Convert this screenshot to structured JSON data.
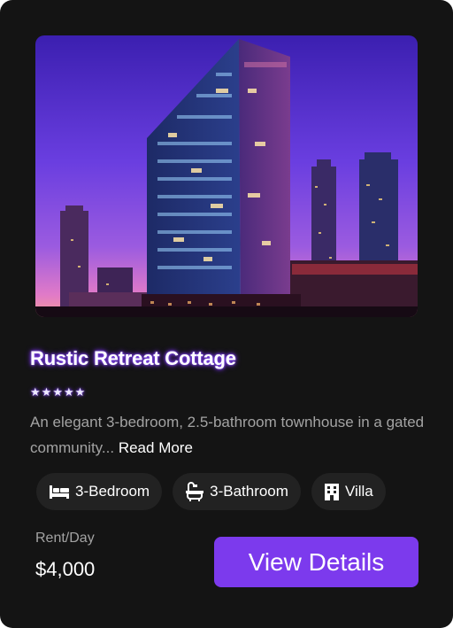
{
  "property": {
    "title": "Rustic Retreat Cottage",
    "rating": 5,
    "stars": [
      "★",
      "★",
      "★",
      "★",
      "★"
    ],
    "description": "An elegant 3-bedroom, 2.5-bathroom townhouse in a gated community...",
    "read_more_label": "Read More"
  },
  "features": [
    {
      "icon": "bed-icon",
      "label": "3-Bedroom"
    },
    {
      "icon": "bathtub-icon",
      "label": "3-Bathroom"
    },
    {
      "icon": "building-icon",
      "label": "Villa"
    }
  ],
  "pricing": {
    "label": "Rent/Day",
    "amount": "$4,000"
  },
  "cta": {
    "label": "View Details"
  },
  "colors": {
    "card_background": "#141414",
    "accent": "#7c3aed",
    "chip_background": "#222222",
    "muted_text": "#a3a3a3"
  }
}
